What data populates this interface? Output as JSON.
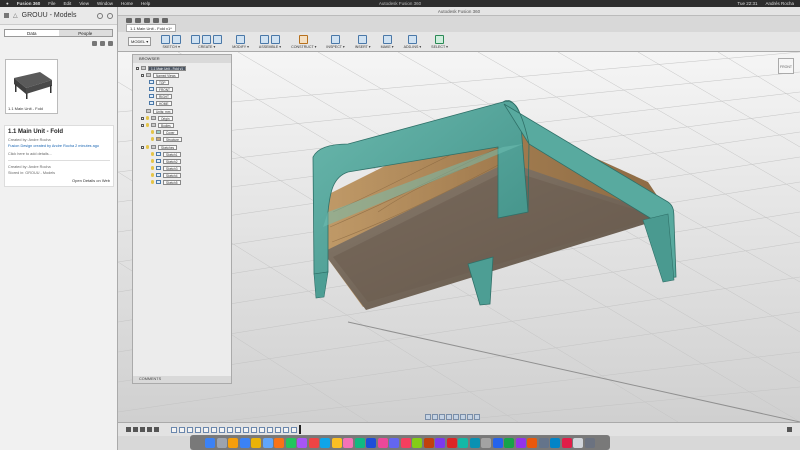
{
  "menubar": {
    "apple": "",
    "app": "Fusion 360",
    "items": [
      "File",
      "Edit",
      "View",
      "Window",
      "Home",
      "Help"
    ],
    "window_title": "Autodesk Fusion 360",
    "clock": "Tue 22:31",
    "user": "Andrés Rocha"
  },
  "left_panel": {
    "project_title": "GROUU - Models",
    "tabs": [
      "Data",
      "People"
    ],
    "thumbnail_caption": "1.1 Main Unit - Fold",
    "details": {
      "title": "1.1 Main Unit - Fold",
      "created_by": "Created by: Andre Rocha",
      "description": "Fusion Design created by Andre Rocha 2 minutes ago",
      "add_desc": "Click here to add details...",
      "meta1": "Created by: Andre Rocha",
      "meta2": "Stored in: GROUU - Models",
      "open_details": "Open Details on Web"
    }
  },
  "app": {
    "doc_tab": "1.1 Main Unit - Fold v1*",
    "workspace": "MODEL ▾",
    "toolbar_groups": [
      {
        "label": "SKETCH ▾",
        "icons": 2
      },
      {
        "label": "CREATE ▾",
        "icons": 3
      },
      {
        "label": "MODIFY ▾",
        "icons": 1
      },
      {
        "label": "ASSEMBLE ▾",
        "icons": 2
      },
      {
        "label": "CONSTRUCT ▾",
        "icons": 1
      },
      {
        "label": "INSPECT ▾",
        "icons": 1
      },
      {
        "label": "INSERT ▾",
        "icons": 1
      },
      {
        "label": "MAKE ▾",
        "icons": 1
      },
      {
        "label": "ADD-INS ▾",
        "icons": 1
      },
      {
        "label": "SELECT ▾",
        "icons": 1
      }
    ],
    "viewcube": "FRONT"
  },
  "browser": {
    "header": "BROWSER",
    "root": "1.1 Main Unit - Fold v1",
    "items": [
      {
        "label": "Named Views",
        "type": "folder",
        "indent": 1
      },
      {
        "label": "TOP",
        "type": "view",
        "indent": 2
      },
      {
        "label": "FRONT",
        "type": "view",
        "indent": 2
      },
      {
        "label": "RIGHT",
        "type": "view",
        "indent": 2
      },
      {
        "label": "HOME",
        "type": "view",
        "indent": 2
      },
      {
        "label": "Units: mm",
        "type": "units",
        "indent": 1
      },
      {
        "label": "Origin",
        "type": "folder",
        "indent": 1
      },
      {
        "label": "Bodies",
        "type": "folder",
        "indent": 1
      },
      {
        "label": "Cover",
        "type": "body",
        "indent": 2
      },
      {
        "label": "Structure",
        "type": "body",
        "indent": 2
      },
      {
        "label": "Sketches",
        "type": "folder",
        "indent": 1
      },
      {
        "label": "Sketch1",
        "type": "sketch",
        "indent": 2
      },
      {
        "label": "Sketch2",
        "type": "sketch",
        "indent": 2
      },
      {
        "label": "Sketch3",
        "type": "sketch",
        "indent": 2
      },
      {
        "label": "Sketch4",
        "type": "sketch",
        "indent": 2
      },
      {
        "label": "Sketch5",
        "type": "sketch",
        "indent": 2
      }
    ],
    "comments": "COMMENTS"
  },
  "colors": {
    "teal": "#52a39a",
    "wood": "#b08a5c",
    "grid": "#b8b8b8"
  }
}
